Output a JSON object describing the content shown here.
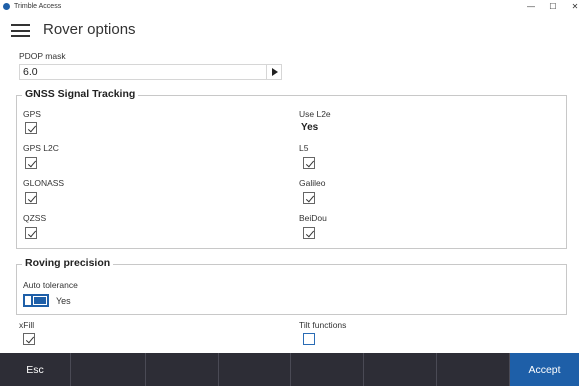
{
  "window": {
    "title": "Trimble Access",
    "min_glyph": "—",
    "max_glyph": "☐",
    "close_glyph": "✕"
  },
  "header": {
    "title": "Rover options"
  },
  "pdop": {
    "label": "PDOP mask",
    "value": "6.0"
  },
  "gnss": {
    "title": "GNSS Signal Tracking",
    "left": [
      {
        "label": "GPS",
        "checked": true
      },
      {
        "label": "GPS L2C",
        "checked": true
      },
      {
        "label": "GLONASS",
        "checked": true
      },
      {
        "label": "QZSS",
        "checked": true
      }
    ],
    "use_l2e": {
      "label": "Use L2e",
      "value": "Yes"
    },
    "right": [
      {
        "label": "L5",
        "checked": true
      },
      {
        "label": "Galileo",
        "checked": true
      },
      {
        "label": "BeiDou",
        "checked": true
      }
    ]
  },
  "roving": {
    "title": "Roving precision",
    "auto_tolerance_label": "Auto tolerance",
    "auto_tolerance_value": "Yes",
    "auto_tolerance_on": true
  },
  "xfill": {
    "label": "xFill",
    "checked": true
  },
  "tilt": {
    "label": "Tilt functions",
    "checked": false
  },
  "footer": {
    "esc_label": "Esc",
    "accept_label": "Accept"
  },
  "colors": {
    "accent": "#1e5fa8",
    "footer_bg": "#2d2d36"
  }
}
